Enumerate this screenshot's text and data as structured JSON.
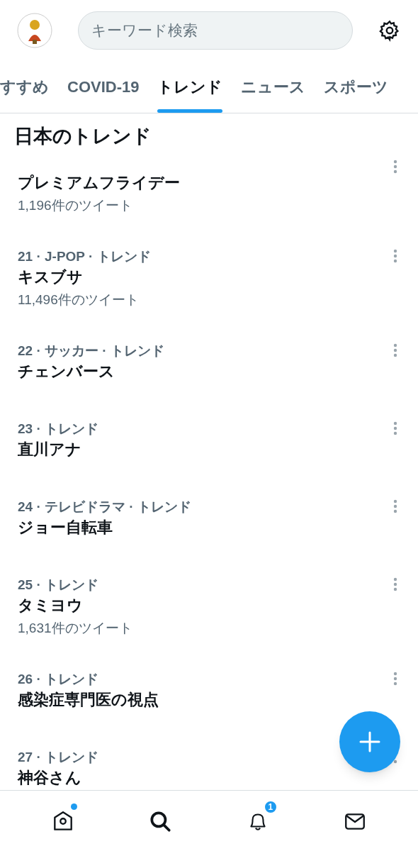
{
  "search": {
    "placeholder": "キーワード検索"
  },
  "tabs": [
    {
      "label": "すすめ",
      "selected": false
    },
    {
      "label": "COVID-19",
      "selected": false
    },
    {
      "label": "トレンド",
      "selected": true
    },
    {
      "label": "ニュース",
      "selected": false
    },
    {
      "label": "スポーツ",
      "selected": false
    }
  ],
  "section_title": "日本のトレンド",
  "trends": [
    {
      "title": "プレミアムフライデー",
      "count": "1,196件のツイート"
    },
    {
      "meta": "21 · J-POP · トレンド",
      "title": "キスブサ",
      "count": "11,496件のツイート"
    },
    {
      "meta": "22 · サッカー · トレンド",
      "title": "チェンバース"
    },
    {
      "meta": "23 · トレンド",
      "title": "直川アナ"
    },
    {
      "meta": "24 · テレビドラマ · トレンド",
      "title": "ジョー自転車"
    },
    {
      "meta": "25 · トレンド",
      "title": "タミヨウ",
      "count": "1,631件のツイート"
    },
    {
      "meta": "26 · トレンド",
      "title": "感染症専門医の視点"
    },
    {
      "meta": "27 · トレンド",
      "title": "神谷さん"
    }
  ],
  "bottom_nav": [
    {
      "kind": "home",
      "dot": true
    },
    {
      "kind": "search"
    },
    {
      "kind": "bell",
      "badge": "1"
    },
    {
      "kind": "mail"
    }
  ]
}
